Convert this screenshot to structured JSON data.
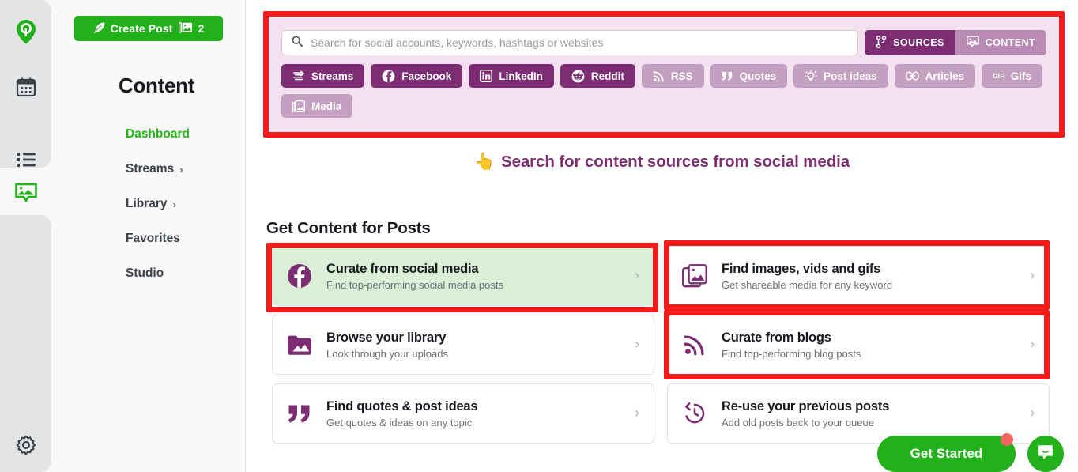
{
  "rail": {
    "items": [
      {
        "name": "logo",
        "icon": "location-pin-logo-icon",
        "state": "logo"
      },
      {
        "name": "calendar",
        "icon": "calendar-icon",
        "state": "inactive"
      },
      {
        "name": "queue",
        "icon": "list-icon",
        "state": "inactive"
      },
      {
        "name": "content",
        "icon": "media-content-icon",
        "state": "active"
      },
      {
        "name": "settings",
        "icon": "gear-icon",
        "state": "inactive"
      }
    ]
  },
  "sidebar": {
    "create_post": {
      "label": "Create Post",
      "count": "2",
      "icon": "feather-icon",
      "media_icon": "image-icon"
    },
    "title": "Content",
    "items": [
      {
        "label": "Dashboard",
        "active": true,
        "chevron": ""
      },
      {
        "label": "Streams",
        "active": false,
        "chevron": "›"
      },
      {
        "label": "Library",
        "active": false,
        "chevron": "›"
      },
      {
        "label": "Favorites",
        "active": false,
        "chevron": ""
      },
      {
        "label": "Studio",
        "active": false,
        "chevron": ""
      }
    ]
  },
  "search_panel": {
    "input": {
      "value": "",
      "placeholder": "Search for social accounts, keywords, hashtags or websites",
      "icon": "search-icon"
    },
    "toggles": [
      {
        "label": "SOURCES",
        "icon": "sources-branch-icon",
        "active": true
      },
      {
        "label": "CONTENT",
        "icon": "content-media-icon",
        "active": false
      }
    ],
    "chip_rows": [
      [
        {
          "label": "Streams",
          "icon": "streams-icon",
          "active": true
        },
        {
          "label": "Facebook",
          "icon": "facebook-icon",
          "active": true
        },
        {
          "label": "LinkedIn",
          "icon": "linkedin-icon",
          "active": true
        },
        {
          "label": "Reddit",
          "icon": "reddit-icon",
          "active": true
        },
        {
          "label": "RSS",
          "icon": "rss-icon",
          "active": false
        },
        {
          "label": "Quotes",
          "icon": "quote-icon",
          "active": false
        },
        {
          "label": "Post ideas",
          "icon": "lightbulb-icon",
          "active": false
        },
        {
          "label": "Articles",
          "icon": "link-icon",
          "active": false
        },
        {
          "label": "Gifs",
          "icon": "gif-icon",
          "active": false
        }
      ],
      [
        {
          "label": "Media",
          "icon": "media-stack-icon",
          "active": false
        }
      ]
    ]
  },
  "callout": {
    "hand": "👆",
    "text": "Search for content sources from social media"
  },
  "cards_section": {
    "heading": "Get Content for Posts",
    "left_column": [
      {
        "title": "Curate from social media",
        "subtitle": "Find top-performing social media posts",
        "icon": "facebook-circle-icon",
        "highlighted": true,
        "chevron": "›"
      },
      {
        "title": "Browse your library",
        "subtitle": "Look through your uploads",
        "icon": "folder-image-icon",
        "highlighted": false,
        "chevron": "›"
      },
      {
        "title": "Find quotes & post ideas",
        "subtitle": "Get quotes & ideas on any topic",
        "icon": "quote-marks-icon",
        "highlighted": false,
        "chevron": "›"
      }
    ],
    "right_column": [
      {
        "title": "Find images, vids and gifs",
        "subtitle": "Get shareable media for any keyword",
        "icon": "image-stack-icon",
        "highlighted": false,
        "chevron": "›"
      },
      {
        "title": "Curate from blogs",
        "subtitle": "Find top-performing blog posts",
        "icon": "rss-feed-icon",
        "highlighted": false,
        "chevron": "›"
      },
      {
        "title": "Re-use your previous posts",
        "subtitle": "Add old posts back to your queue",
        "icon": "history-clock-icon",
        "highlighted": false,
        "chevron": "›"
      }
    ]
  },
  "footer_widgets": {
    "get_started": {
      "label": "Get Started",
      "has_notification_dot": true
    },
    "chat": {
      "icon": "chat-bubble-icon"
    }
  },
  "colors": {
    "brand_green": "#22b11a",
    "purple_active": "#7c2d74",
    "purple_inactive": "#c4a0c0",
    "panel_pink": "#f4e1f0",
    "highlight_red": "#f51b1b",
    "card_highlight_green": "#d9f0d7",
    "callout_purple": "#7c3070",
    "notification_dot": "#f2645f"
  }
}
